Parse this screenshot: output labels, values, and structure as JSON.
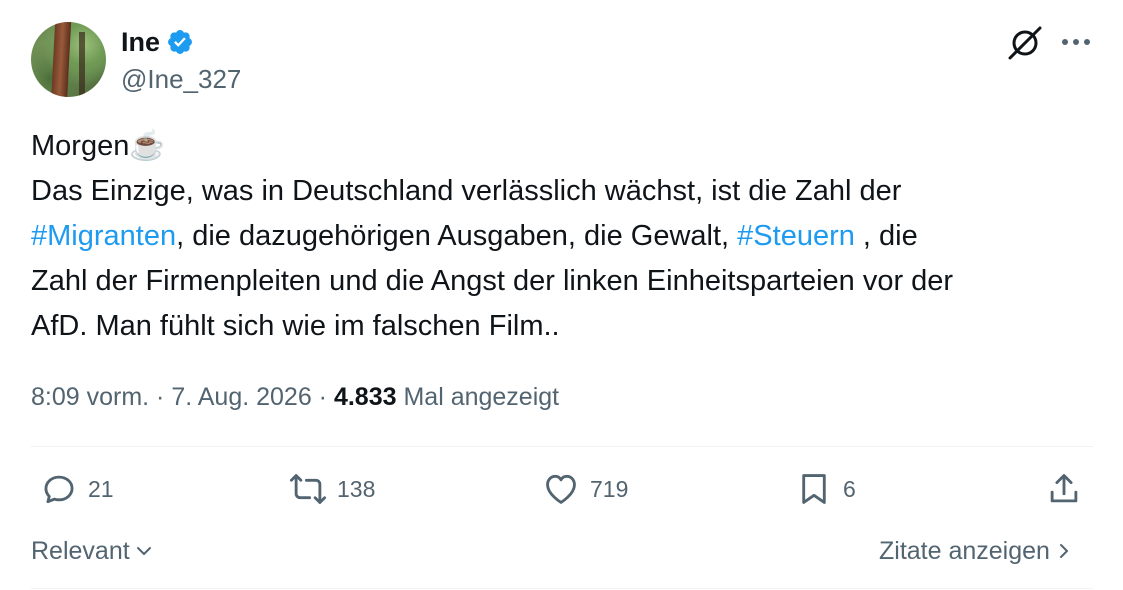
{
  "author": {
    "name": "Ine",
    "handle": "@Ine_327"
  },
  "tweet": {
    "line1": "Morgen☕",
    "line2": "Das Einzige, was in Deutschland verlässlich wächst, ist die Zahl der",
    "line3_tag1": "#Migranten",
    "line3_text1": ", die dazugehörigen Ausgaben, die Gewalt, ",
    "line3_tag2": "#Steuern",
    "line3_text2": " , die",
    "line4": "Zahl der Firmenpleiten und die Angst der linken Einheitsparteien vor der",
    "line5": "AfD. Man fühlt sich wie im falschen Film.."
  },
  "meta": {
    "time": "8:09 vorm.",
    "sep1": " · ",
    "date": "7. Aug. 2026",
    "sep2": " · ",
    "views": "4.833",
    "views_label": " Mal angezeigt"
  },
  "actions": {
    "replies": "21",
    "reposts": "138",
    "likes": "719",
    "bookmarks": "6"
  },
  "footer": {
    "sort_label": "Relevant",
    "quotes_label": "Zitate anzeigen"
  },
  "colors": {
    "accent": "#1d9bf0",
    "text": "#0f1419",
    "secondary": "#536471"
  },
  "icons": {
    "verified": "verified-badge-icon",
    "grok": "grok-icon",
    "more": "more-icon",
    "reply": "reply-icon",
    "repost": "repost-icon",
    "like": "heart-icon",
    "bookmark": "bookmark-icon",
    "share": "share-icon"
  }
}
